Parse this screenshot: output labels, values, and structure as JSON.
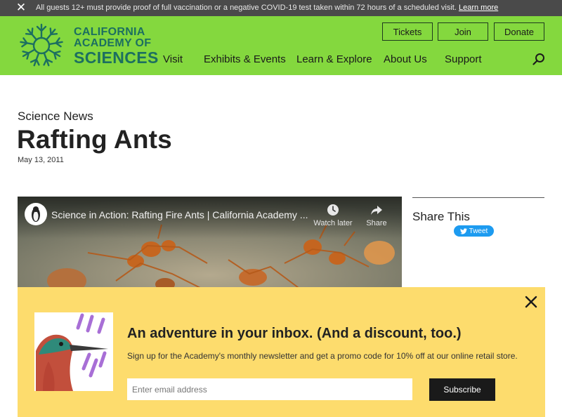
{
  "alert": {
    "text": "All guests 12+ must provide proof of full vaccination or a negative COVID-19 test taken within 72 hours of a scheduled visit.",
    "link": "Learn more"
  },
  "logo": {
    "line1": "CALIFORNIA",
    "line2": "ACADEMY OF",
    "line3": "SCIENCES"
  },
  "utility_nav": {
    "tickets": "Tickets",
    "join": "Join",
    "donate": "Donate"
  },
  "main_nav": [
    "Visit",
    "Exhibits & Events",
    "Learn & Explore",
    "About Us",
    "Support"
  ],
  "article": {
    "kicker": "Science News",
    "title": "Rafting Ants",
    "date": "May 13, 2011"
  },
  "video": {
    "title": "Science in Action: Rafting Fire Ants | California Academy ...",
    "watch_later": "Watch later",
    "share": "Share"
  },
  "share": {
    "title": "Share This",
    "tweet": "Tweet"
  },
  "newsletter": {
    "heading": "An adventure in your inbox. (And a discount, too.)",
    "description": "Sign up for the Academy's monthly newsletter and get a promo code for 10% off at our online retail store.",
    "email_placeholder": "Enter email address",
    "submit": "Subscribe"
  },
  "colors": {
    "header_green": "#84d83e",
    "logo_teal": "#1c6f60",
    "alert_bg": "#4a4a4a",
    "newsletter_bg": "#fddc6d",
    "tweet_blue": "#1d9bf0"
  }
}
